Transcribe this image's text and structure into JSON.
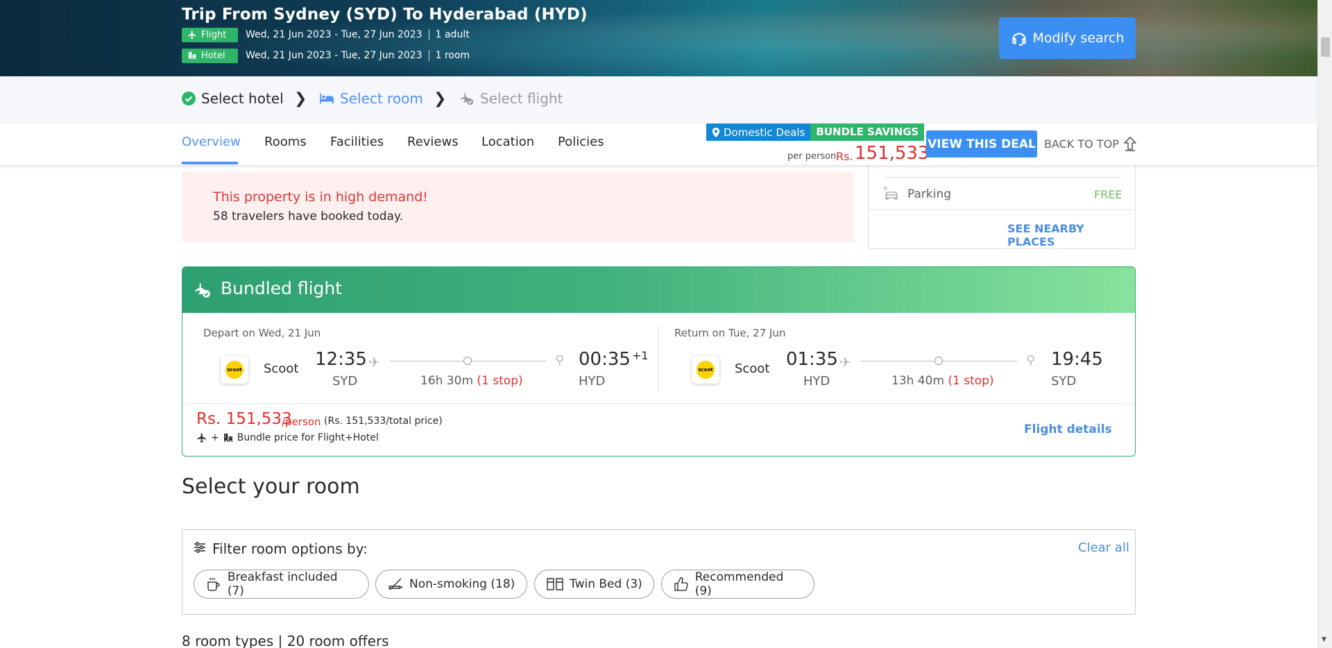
{
  "hero": {
    "title": "Trip From Sydney (SYD) To Hyderabad (HYD)",
    "flight_badge": "Flight",
    "flight_dates": "Wed, 21 Jun 2023 - Tue, 27 Jun 2023",
    "flight_pax": "1 adult",
    "hotel_badge": "Hotel",
    "hotel_dates": "Wed, 21 Jun 2023 - Tue, 27 Jun 2023",
    "hotel_rooms": "1 room",
    "modify_label": "Modify search"
  },
  "steps": {
    "step1": "Select hotel",
    "step2": "Select room",
    "step3": "Select flight"
  },
  "tabs": {
    "items": [
      "Overview",
      "Rooms",
      "Facilities",
      "Reviews",
      "Location",
      "Policies"
    ],
    "active": "Overview",
    "domestic_deals": "Domestic Deals",
    "bundle_savings": "BUNDLE SAVINGS",
    "per_person": "per person",
    "currency": "Rs.",
    "price": "151,533",
    "view_deal": "VIEW THIS DEAL",
    "back_to_top": "BACK TO TOP"
  },
  "demand": {
    "title": "This property is in high demand!",
    "count": "58",
    "subtitle": "travelers have booked today."
  },
  "nearby": {
    "parking_label": "Parking",
    "parking_value": "FREE",
    "see_nearby": "SEE NEARBY PLACES"
  },
  "bundle": {
    "title": "Bundled flight",
    "depart": {
      "label": "Depart on Wed, 21 Jun",
      "airline": "Scoot",
      "dep_time": "12:35",
      "dep_code": "SYD",
      "duration": "16h 30m",
      "stops": "(1 stop)",
      "arr_time": "00:35",
      "arr_plus": "+1",
      "arr_code": "HYD"
    },
    "return": {
      "label": "Return on Tue, 27 Jun",
      "airline": "Scoot",
      "dep_time": "01:35",
      "dep_code": "HYD",
      "duration": "13h 40m",
      "stops": "(1 stop)",
      "arr_time": "19:45",
      "arr_code": "SYD"
    },
    "logo_text": "scoot",
    "price": "Rs. 151,533",
    "per_person": "/person",
    "total": "(Rs. 151,533/total price)",
    "note": "Bundle price for Flight+Hotel",
    "flight_details": "Flight details"
  },
  "rooms": {
    "heading": "Select your room",
    "filter_title": "Filter room options by:",
    "clear_all": "Clear all",
    "filters": [
      {
        "label": "Breakfast included (7)",
        "icon": "coffee-cup-icon"
      },
      {
        "label": "Non-smoking (18)",
        "icon": "no-smoking-icon"
      },
      {
        "label": "Twin Bed (3)",
        "icon": "twin-bed-icon"
      },
      {
        "label": "Recommended (9)",
        "icon": "thumbs-up-icon"
      }
    ],
    "count_text": "8 room types | 20 room offers"
  },
  "colors": {
    "accent": "#5392f9",
    "button": "#3b8ff3",
    "price_red": "#e12d2d",
    "green": "#2fb56a"
  }
}
